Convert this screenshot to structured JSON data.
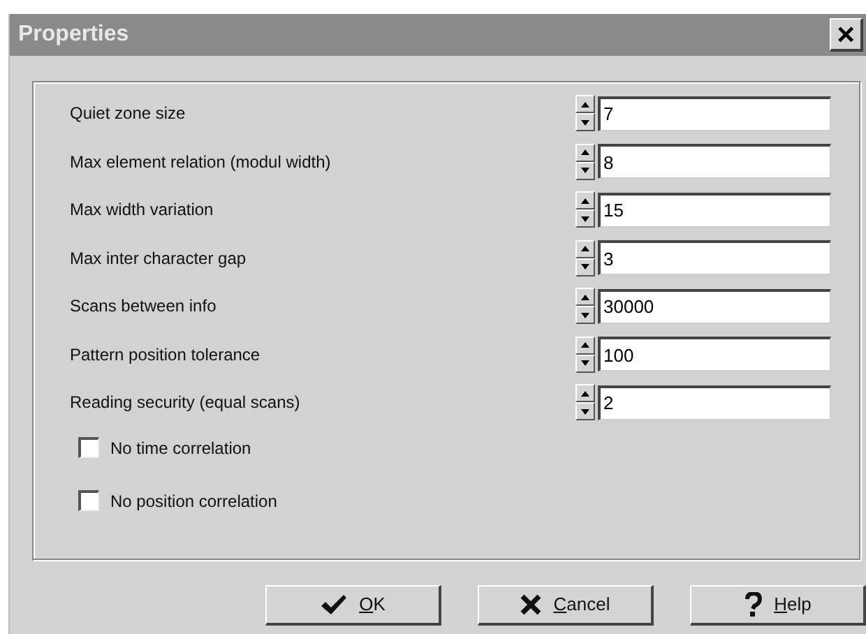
{
  "window": {
    "title": "Properties",
    "close": "×"
  },
  "fields": [
    {
      "label": "Quiet zone size",
      "value": "7"
    },
    {
      "label": "Max element relation (modul width)",
      "value": "8"
    },
    {
      "label": "Max width variation",
      "value": "15"
    },
    {
      "label": "Max inter character gap",
      "value": "3"
    },
    {
      "label": "Scans between info",
      "value": "30000"
    },
    {
      "label": "Pattern position tolerance",
      "value": "100"
    },
    {
      "label": "Reading security (equal scans)",
      "value": "2"
    }
  ],
  "checkboxes": [
    {
      "label": "No time correlation",
      "checked": false
    },
    {
      "label": "No position correlation",
      "checked": false
    }
  ],
  "buttons": [
    {
      "kind": "ok",
      "label": "OK"
    },
    {
      "kind": "cancel",
      "label": "Cancel"
    },
    {
      "kind": "help",
      "label": "Help"
    }
  ]
}
